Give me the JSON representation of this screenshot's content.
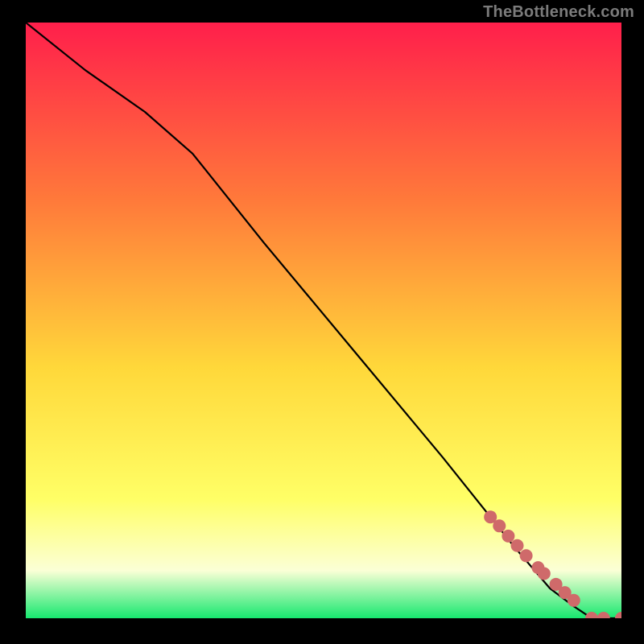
{
  "watermark": "TheBottleneck.com",
  "colors": {
    "gradient_top": "#ff1f4b",
    "gradient_mid_upper": "#ff7a3a",
    "gradient_mid": "#ffd83a",
    "gradient_mid_lower": "#ffff66",
    "gradient_pale": "#fbffd6",
    "gradient_bottom": "#17e86f",
    "line": "#000000",
    "marker": "#cf6a6a",
    "frame": "#000000"
  },
  "chart_data": {
    "type": "line",
    "title": "",
    "xlabel": "",
    "ylabel": "",
    "xlim": [
      0,
      100
    ],
    "ylim": [
      0,
      100
    ],
    "series": [
      {
        "name": "curve",
        "x": [
          0,
          10,
          20,
          28,
          40,
          55,
          70,
          82,
          88,
          92,
          95,
          97,
          100
        ],
        "y": [
          100,
          92,
          85,
          78,
          63,
          45,
          27,
          12,
          5,
          2,
          0,
          0,
          0
        ]
      }
    ],
    "markers": {
      "name": "highlight-points",
      "x": [
        78,
        79.5,
        81,
        82.5,
        84,
        86,
        87,
        89,
        90.5,
        92,
        95,
        97,
        100
      ],
      "y": [
        17,
        15.5,
        13.8,
        12.2,
        10.5,
        8.5,
        7.5,
        5.7,
        4.3,
        3.0,
        0,
        0,
        0
      ]
    }
  }
}
